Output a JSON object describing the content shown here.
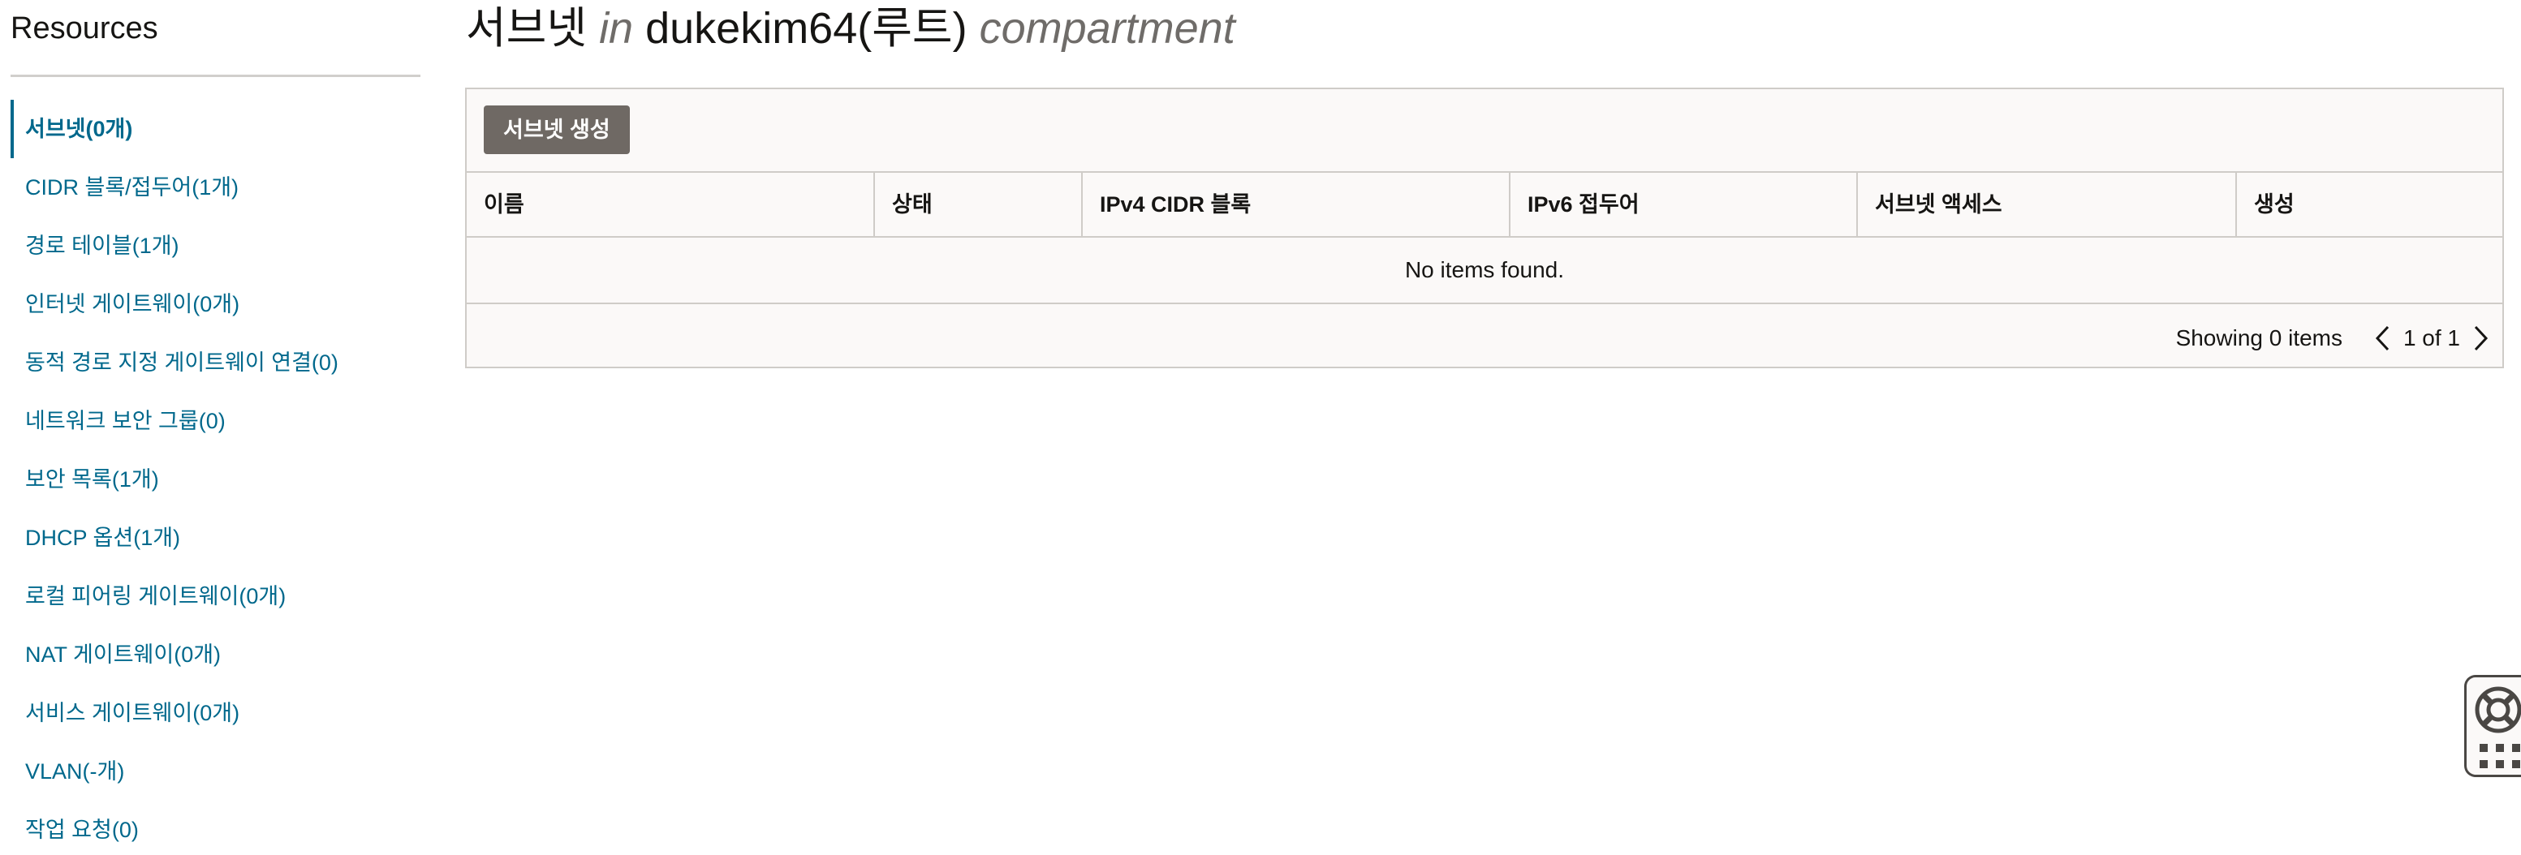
{
  "sidebar": {
    "title": "Resources",
    "items": [
      {
        "label": "서브넷(0개)"
      },
      {
        "label": "CIDR 블록/접두어(1개)"
      },
      {
        "label": "경로 테이블(1개)"
      },
      {
        "label": "인터넷 게이트웨이(0개)"
      },
      {
        "label": "동적 경로 지정 게이트웨이 연결(0)"
      },
      {
        "label": "네트워크 보안 그룹(0)"
      },
      {
        "label": "보안 목록(1개)"
      },
      {
        "label": "DHCP 옵션(1개)"
      },
      {
        "label": "로컬 피어링 게이트웨이(0개)"
      },
      {
        "label": "NAT 게이트웨이(0개)"
      },
      {
        "label": "서비스 게이트웨이(0개)"
      },
      {
        "label": "VLAN(-개)"
      },
      {
        "label": "작업 요청(0)"
      }
    ],
    "active_index": 0
  },
  "main": {
    "title_resource": "서브넷",
    "title_in": "in",
    "title_compartment_name": "dukekim64(루트)",
    "title_compartment_word": "compartment"
  },
  "table": {
    "create_button_label": "서브넷 생성",
    "columns": [
      {
        "label": "이름"
      },
      {
        "label": "상태"
      },
      {
        "label": "IPv4 CIDR 블록"
      },
      {
        "label": "IPv6 접두어"
      },
      {
        "label": "서브넷 액세스"
      },
      {
        "label": "생성"
      }
    ],
    "empty_message": "No items found.",
    "showing_text": "Showing 0 items",
    "page_text": "1 of 1"
  },
  "icons": {
    "help": "lifebuoy-icon",
    "apps": "grid-icon",
    "prev": "chevron-left-icon",
    "next": "chevron-right-icon"
  },
  "colors": {
    "link": "#00688c",
    "button_bg": "#6f6964",
    "border": "#cfccc8"
  }
}
